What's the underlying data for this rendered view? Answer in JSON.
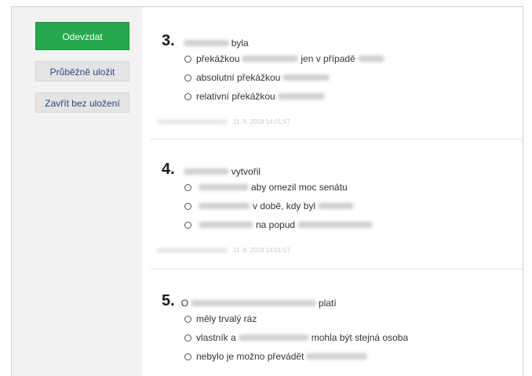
{
  "sidebar": {
    "submit_label": "Odevzdat",
    "save_label": "Průběžně uložit",
    "close_label": "Zavřít bez uložení"
  },
  "questions": [
    {
      "number": "3.",
      "text_visible": "byla",
      "options": [
        {
          "parts": [
            "překážkou",
            "jen v případě"
          ]
        },
        {
          "parts": [
            "absolutní překážkou"
          ]
        },
        {
          "parts": [
            "relativní překážkou"
          ]
        }
      ],
      "timestamp": "11. 8. 2019 14:01:57"
    },
    {
      "number": "4.",
      "text_visible": "vytvořil",
      "options": [
        {
          "parts": [
            "aby omezil moc senátu"
          ]
        },
        {
          "parts": [
            "v době, kdy byl"
          ]
        },
        {
          "parts": [
            "na popud"
          ]
        }
      ],
      "timestamp": "11. 8. 2019 14:01:57"
    },
    {
      "number": "5.",
      "text_prefix": "O",
      "text_visible": "platí",
      "options": [
        {
          "parts": [
            "měly trvalý ráz"
          ]
        },
        {
          "parts": [
            "vlastník a",
            "mohla být stejná osoba"
          ]
        },
        {
          "parts": [
            "nebylo je možno převádět"
          ]
        }
      ]
    }
  ]
}
